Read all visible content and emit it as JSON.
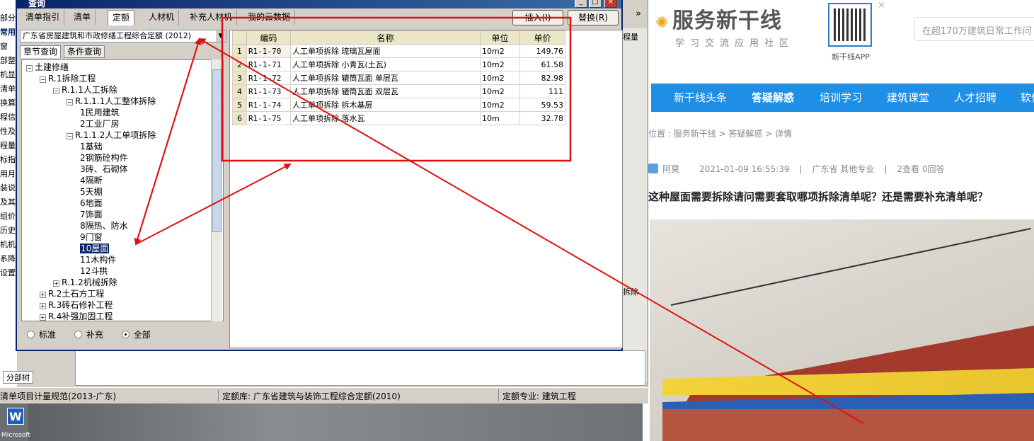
{
  "dialog": {
    "title": "查询",
    "tabs": [
      "清单指引",
      "清单",
      "定额",
      "人材机",
      "补充人材机",
      "我的云数据"
    ],
    "active_tab": "定额",
    "insert_button": "插入(I)",
    "replace_button": "替换(R)",
    "overflow": "»",
    "library_combo": "广东省房屋建筑和市政修缮工程综合定额 (2012)",
    "left_tabs": [
      "章节查询",
      "条件查询"
    ],
    "tree": [
      {
        "label": "土建修缮",
        "toggle": "−",
        "level": 0
      },
      {
        "label": "R.1拆除工程",
        "toggle": "−",
        "level": 1
      },
      {
        "label": "R.1.1人工拆除",
        "toggle": "−",
        "level": 2
      },
      {
        "label": "R.1.1.1人工整体拆除",
        "toggle": "−",
        "level": 3
      },
      {
        "label": "1民用建筑",
        "toggle": "",
        "level": 4
      },
      {
        "label": "2工业厂房",
        "toggle": "",
        "level": 4
      },
      {
        "label": "R.1.1.2人工单项拆除",
        "toggle": "−",
        "level": 3
      },
      {
        "label": "1基础",
        "toggle": "",
        "level": 4
      },
      {
        "label": "2钢筋砼构件",
        "toggle": "",
        "level": 4
      },
      {
        "label": "3砖、石砌体",
        "toggle": "",
        "level": 4
      },
      {
        "label": "4隔断",
        "toggle": "",
        "level": 4
      },
      {
        "label": "5天棚",
        "toggle": "",
        "level": 4
      },
      {
        "label": "6地面",
        "toggle": "",
        "level": 4
      },
      {
        "label": "7饰面",
        "toggle": "",
        "level": 4
      },
      {
        "label": "8隔热、防水",
        "toggle": "",
        "level": 4
      },
      {
        "label": "9门窗",
        "toggle": "",
        "level": 4
      },
      {
        "label": "10屋面",
        "toggle": "",
        "level": 4,
        "selected": true
      },
      {
        "label": "11木构件",
        "toggle": "",
        "level": 4
      },
      {
        "label": "12斗拱",
        "toggle": "",
        "level": 4
      },
      {
        "label": "R.1.2机械拆除",
        "toggle": "+",
        "level": 2
      },
      {
        "label": "R.2土石方工程",
        "toggle": "+",
        "level": 1
      },
      {
        "label": "R.3砖石修补工程",
        "toggle": "+",
        "level": 1
      },
      {
        "label": "R.4补强加固工程",
        "toggle": "+",
        "level": 1
      }
    ],
    "radios": [
      {
        "label": "标准",
        "checked": false
      },
      {
        "label": "补充",
        "checked": false
      },
      {
        "label": "全部",
        "checked": true
      }
    ],
    "grid": {
      "columns": [
        "编码",
        "名称",
        "单位",
        "单价"
      ],
      "rows": [
        {
          "n": "1",
          "code": "R1-1-70",
          "name": "人工单项拆除 琉璃瓦屋面",
          "unit": "10m2",
          "price": "149.76"
        },
        {
          "n": "2",
          "code": "R1-1-71",
          "name": "人工单项拆除 小青瓦(土瓦)",
          "unit": "10m2",
          "price": "61.58"
        },
        {
          "n": "3",
          "code": "R1-1-72",
          "name": "人工单项拆除 辘筒瓦面 单层瓦",
          "unit": "10m2",
          "price": "82.98"
        },
        {
          "n": "4",
          "code": "R1-1-73",
          "name": "人工单项拆除 辘筒瓦面 双层瓦",
          "unit": "10m2",
          "price": "111"
        },
        {
          "n": "5",
          "code": "R1-1-74",
          "name": "人工单项拆除 拆木基层",
          "unit": "10m2",
          "price": "59.53"
        },
        {
          "n": "6",
          "code": "R1-1-75",
          "name": "人工单项拆除 落水瓦",
          "unit": "10m",
          "price": "32.78"
        }
      ]
    }
  },
  "background_app": {
    "left_strip": [
      "部分",
      "常用",
      "窗",
      "部整理",
      "机显",
      "清单价",
      "换算",
      "程信息",
      "性及内",
      "程量明",
      "标指引",
      "用月",
      "装说明",
      "及其",
      "组价",
      "历史",
      "机机拉",
      "系降效",
      "设置"
    ],
    "bottom_tab": "分部树",
    "right_fragments": [
      "程量",
      "拆除"
    ],
    "status": [
      "清单项目计量规范(2013-广东)",
      "定额库: 广东省建筑与装饰工程综合定额(2010)",
      "定额专业: 建筑工程"
    ]
  },
  "taskbar": {
    "word_icon": "W",
    "word_label": "Microsoft"
  },
  "web": {
    "brand": "服务新干线",
    "slogan": "学习交流应用社区",
    "qr_label": "新干线APP",
    "qr_close": "×",
    "search_placeholder": "在超170万建筑日常工作问",
    "nav": [
      "新干线头条",
      "答疑解惑",
      "培训学习",
      "建筑课堂",
      "人才招聘",
      "软件"
    ],
    "nav_active": "答疑解惑",
    "breadcrumb": "位置 : 服务新干线 > 答疑解惑 > 详情",
    "author": "阿莫",
    "datetime": "2021-01-09 16:55:39",
    "region": "广东省",
    "specialty": "其他专业",
    "views": "2查看",
    "answers": "0回答",
    "question": "这种屋面需要拆除请问需要套取哪项拆除清单呢？还是需要补充清单呢？"
  },
  "colors": {
    "annotation": "#e01010",
    "nav": "#1f8fe6",
    "title_bar": "#0a246a",
    "selection": "#0a246a"
  }
}
